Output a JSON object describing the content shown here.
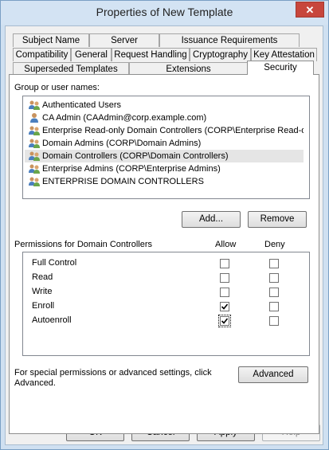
{
  "window": {
    "title": "Properties of New Template",
    "close_glyph": "✕"
  },
  "tabs": {
    "row1": [
      "Subject Name",
      "Server",
      "Issuance Requirements"
    ],
    "row2": [
      "Compatibility",
      "General",
      "Request Handling",
      "Cryptography",
      "Key Attestation"
    ],
    "row3": [
      "Superseded Templates",
      "Extensions",
      "Security"
    ],
    "active": "Security"
  },
  "security": {
    "group_label": "Group or user names:",
    "principals": [
      {
        "name": "Authenticated Users",
        "icon": "group-icon"
      },
      {
        "name": "CA Admin (CAAdmin@corp.example.com)",
        "icon": "user-icon"
      },
      {
        "name": "Enterprise Read-only Domain Controllers (CORP\\Enterprise Read-o...",
        "icon": "group-icon"
      },
      {
        "name": "Domain Admins (CORP\\Domain Admins)",
        "icon": "group-icon"
      },
      {
        "name": "Domain Controllers (CORP\\Domain Controllers)",
        "icon": "group-icon",
        "selected": true
      },
      {
        "name": "Enterprise Admins (CORP\\Enterprise Admins)",
        "icon": "group-icon"
      },
      {
        "name": "ENTERPRISE DOMAIN CONTROLLERS",
        "icon": "group-icon"
      }
    ],
    "add_label": "Add...",
    "remove_label": "Remove",
    "permissions_label": "Permissions for Domain Controllers",
    "allow_label": "Allow",
    "deny_label": "Deny",
    "permissions": [
      {
        "name": "Full Control",
        "allow": false,
        "deny": false
      },
      {
        "name": "Read",
        "allow": false,
        "deny": false
      },
      {
        "name": "Write",
        "allow": false,
        "deny": false
      },
      {
        "name": "Enroll",
        "allow": true,
        "deny": false
      },
      {
        "name": "Autoenroll",
        "allow": true,
        "deny": false
      }
    ],
    "advanced_text_line1": "For special permissions or advanced settings, click",
    "advanced_text_line2": "Advanced.",
    "advanced_label": "Advanced"
  },
  "footer": {
    "ok_label": "OK",
    "cancel_label": "Cancel",
    "apply_label": "Apply",
    "help_label": "Help"
  },
  "colors": {
    "titlebar": "#d3e3f3",
    "close_button": "#c7463c",
    "selected_row": "#e5e5e5"
  }
}
